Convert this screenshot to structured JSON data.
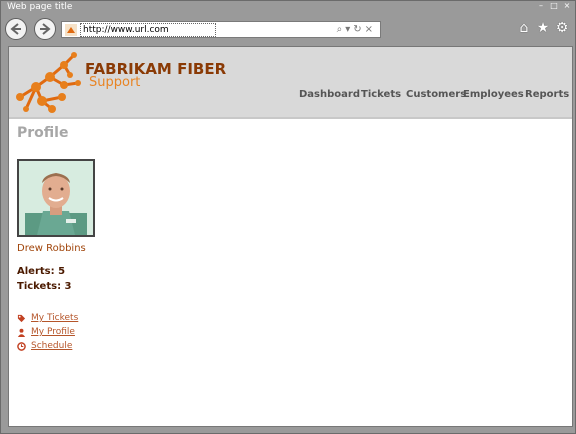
{
  "window": {
    "title": "Web page title"
  },
  "address_bar": {
    "url": "http://www.url.com"
  },
  "site": {
    "brand_name": "FABRIKAM FIBER",
    "brand_sub": "Support"
  },
  "nav": [
    "Dashboard",
    "Tickets",
    "Customers",
    "Employees",
    "Reports"
  ],
  "profile": {
    "title": "Profile",
    "name": "Drew Robbins",
    "alerts": "Alerts: 5",
    "tickets": "Tickets: 3",
    "links": [
      "My Tickets",
      "My Profile",
      "Schedule"
    ]
  },
  "colors": {
    "brand_dark": "#8a3a05",
    "brand_orange": "#e88424",
    "link": "#b5552a"
  },
  "icons": [
    "back-arrow-icon",
    "forward-arrow-icon",
    "home-icon",
    "star-icon",
    "gear-icon",
    "tag-icon",
    "person-icon",
    "clock-icon"
  ]
}
